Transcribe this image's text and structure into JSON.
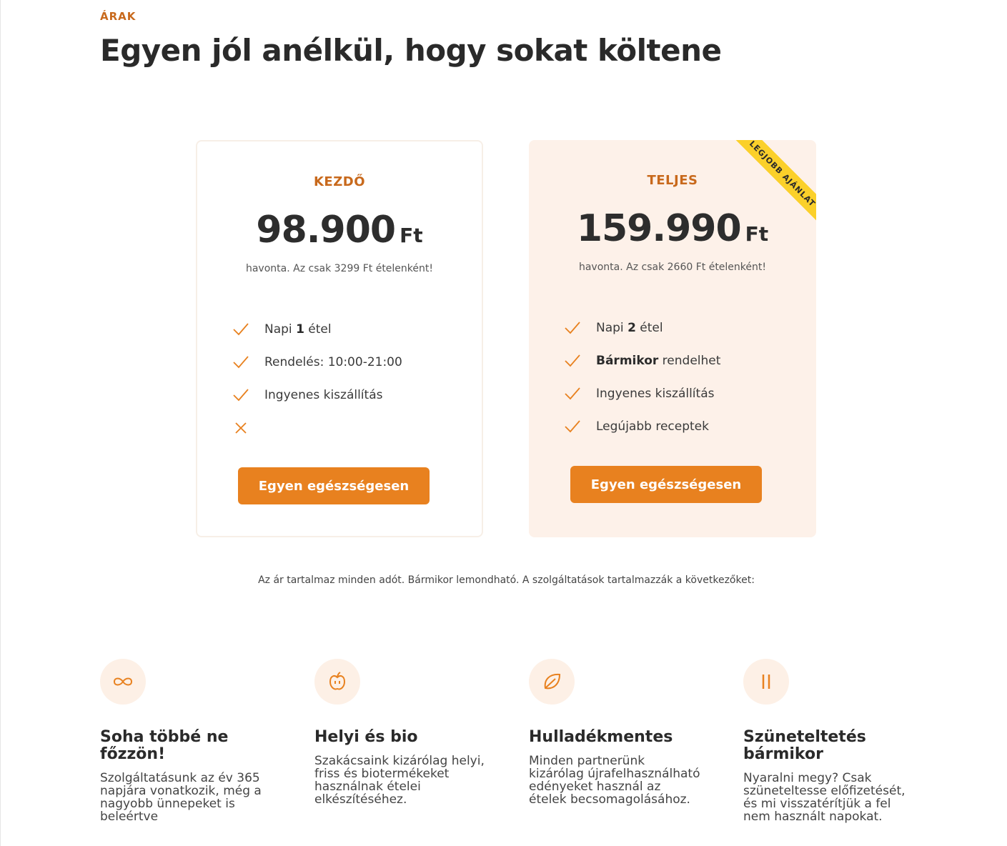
{
  "section": {
    "eyebrow": "ÁRAK",
    "title": "Egyen jól anélkül, hogy sokat költene"
  },
  "plans": [
    {
      "name": "KEZDŐ",
      "price": "98.900",
      "currency": "Ft",
      "per": "havonta. Az csak 3299 Ft ételenként!",
      "features": [
        {
          "mark": "check",
          "pre": "Napi ",
          "bold": "1",
          "post": " étel"
        },
        {
          "mark": "check",
          "pre": "Rendelés: 10:00-21:00",
          "bold": "",
          "post": ""
        },
        {
          "mark": "check",
          "pre": "Ingyenes kiszállítás",
          "bold": "",
          "post": ""
        },
        {
          "mark": "cross",
          "pre": "",
          "bold": "",
          "post": ""
        }
      ],
      "cta": "Egyen egészségesen"
    },
    {
      "name": "TELJES",
      "price": "159.990",
      "currency": "Ft",
      "per": "havonta. Az csak 2660 Ft ételenként!",
      "ribbon": "LEGJOBB AJÁNLAT",
      "features": [
        {
          "mark": "check",
          "pre": "Napi ",
          "bold": "2",
          "post": " étel"
        },
        {
          "mark": "check",
          "pre": "",
          "bold": "Bármikor",
          "post": " rendelhet"
        },
        {
          "mark": "check",
          "pre": "Ingyenes kiszállítás",
          "bold": "",
          "post": ""
        },
        {
          "mark": "check",
          "pre": "Legújabb receptek",
          "bold": "",
          "post": ""
        }
      ],
      "cta": "Egyen egészségesen"
    }
  ],
  "note": "Az ár tartalmaz minden adót. Bármikor lemondható. A szolgáltatások tartalmazzák a következőket:",
  "benefits": [
    {
      "icon": "infinity-icon",
      "title": "Soha többé ne főzzön!",
      "text": "Szolgáltatásunk az év 365 napjára vonatkozik, még a nagyobb ünnepeket is beleértve"
    },
    {
      "icon": "apple-icon",
      "title": "Helyi és bio",
      "text": "Szakácsaink kizárólag helyi, friss és biotermékeket használnak ételei elkészítéséhez."
    },
    {
      "icon": "leaf-icon",
      "title": "Hulladékmentes",
      "text": "Minden partnerünk kizárólag újrafelhasználható edényeket használ az ételek becsomagolásához."
    },
    {
      "icon": "pause-icon",
      "title": "Szüneteltetés bármikor",
      "text": "Nyaralni megy? Csak szüneteltesse előfizetését, és mi visszatérítjük a fel nem használt napokat."
    }
  ],
  "colors": {
    "accent": "#e8811f",
    "accent_text": "#c8691c",
    "highlight_bg": "#fdf1e9",
    "ribbon": "#fbd02a"
  }
}
